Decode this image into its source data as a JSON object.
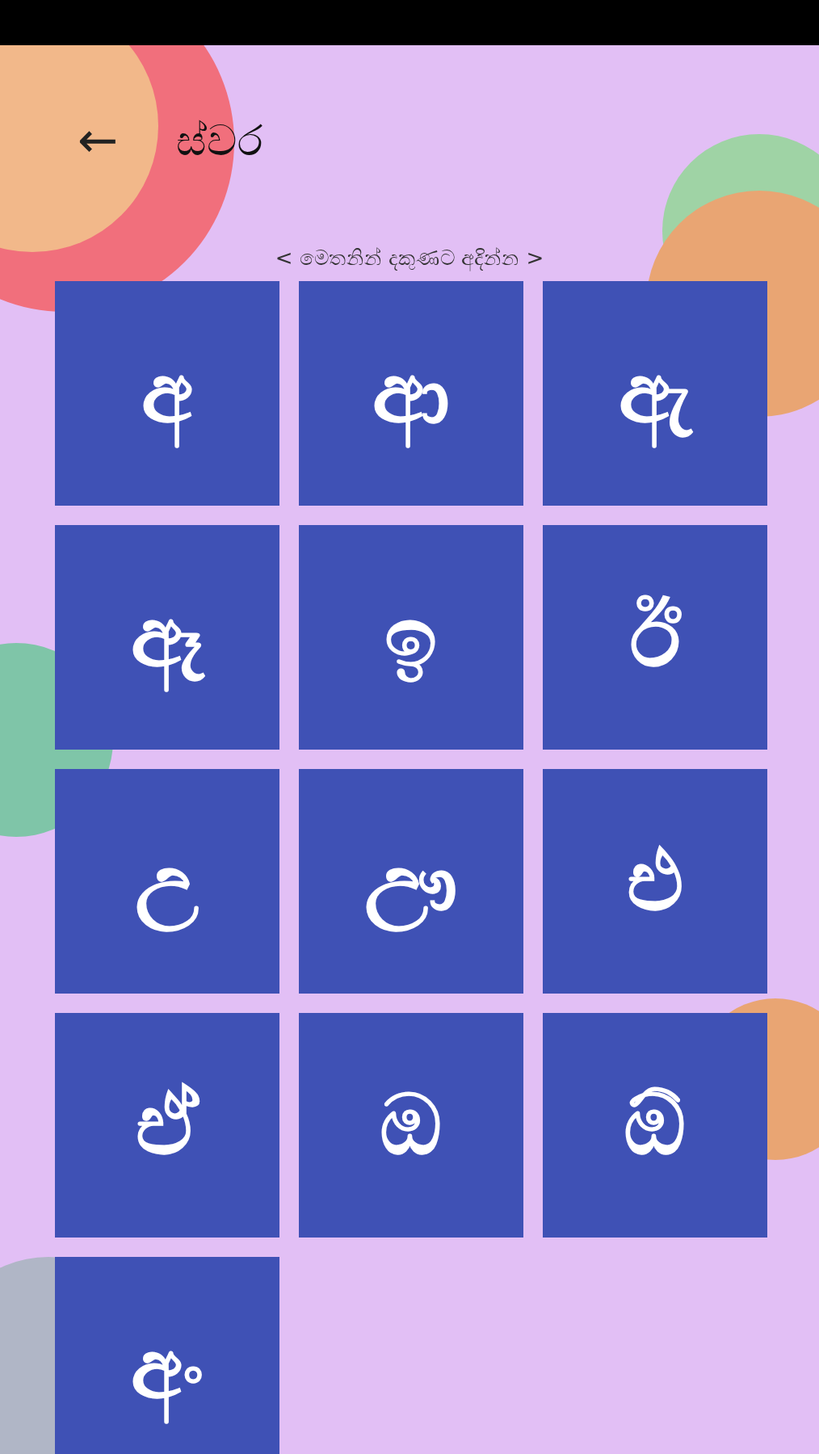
{
  "header": {
    "back": "←",
    "title": "ස්වර"
  },
  "hint": "< මෙතනින් දකුණට අදින්න >",
  "letters": [
    "අ",
    "ආ",
    "ඇ",
    "ඈ",
    "ඉ",
    "ඊ",
    "උ",
    "ඌ",
    "එ",
    "ඒ",
    "ඔ",
    "ඕ",
    "අං"
  ]
}
